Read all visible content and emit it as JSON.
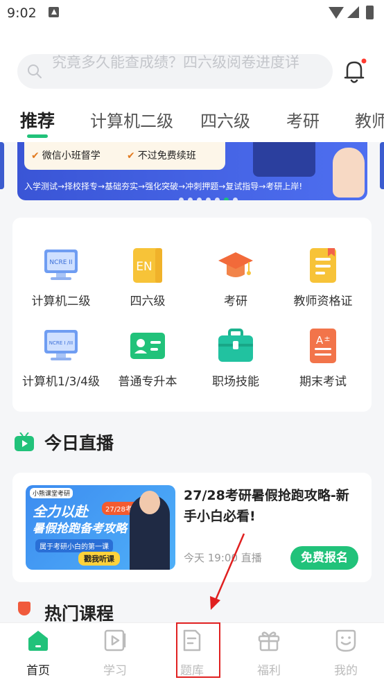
{
  "status_bar": {
    "time": "9:02"
  },
  "search": {
    "placeholder": "究竟多久能查成绩？四六级阅卷进度详"
  },
  "tabs": [
    {
      "label": "推荐",
      "active": true
    },
    {
      "label": "计算机二级"
    },
    {
      "label": "四六级"
    },
    {
      "label": "考研"
    },
    {
      "label": "教师"
    }
  ],
  "banner": {
    "features": [
      "微信小班督学",
      "不过免费续班"
    ],
    "path": "入学测试→择校择专→基础夯实→强化突破→冲刺押题→复试指导→考研上岸!",
    "active_dot": 5,
    "dot_count": 7
  },
  "categories": [
    {
      "label": "计算机二级",
      "icon": "ncre-monitor-icon",
      "icon_text": "NCRE II"
    },
    {
      "label": "四六级",
      "icon": "en-book-icon",
      "icon_text": "EN"
    },
    {
      "label": "考研",
      "icon": "graduation-cap-icon"
    },
    {
      "label": "教师资格证",
      "icon": "certificate-icon"
    },
    {
      "label": "计算机1/3/4级",
      "icon": "ncre-levels-monitor-icon",
      "icon_text": "NCRE I /III"
    },
    {
      "label": "普通专升本",
      "icon": "id-card-icon"
    },
    {
      "label": "职场技能",
      "icon": "briefcase-icon"
    },
    {
      "label": "期末考试",
      "icon": "exam-paper-icon"
    }
  ],
  "live": {
    "section_title": "今日直播",
    "course": {
      "title": "27/28考研暑假抢跑攻略-新手小白必看!",
      "time": "今天 19:00 直播",
      "button": "免费报名",
      "thumbnail": {
        "brand": "小熊课堂考研",
        "line1": "全力以赴",
        "badge": "27/28考研",
        "line2": "暑假抢跑备考攻略",
        "sub": "属于考研小白的第一课",
        "cta": "戳我听课"
      }
    }
  },
  "next_section": {
    "title": "热门课程"
  },
  "bottom_nav": [
    {
      "label": "首页",
      "icon": "home-icon",
      "active": true
    },
    {
      "label": "学习",
      "icon": "play-book-icon"
    },
    {
      "label": "题库",
      "icon": "question-bank-icon"
    },
    {
      "label": "福利",
      "icon": "gift-icon"
    },
    {
      "label": "我的",
      "icon": "smiley-profile-icon"
    }
  ],
  "colors": {
    "accent": "#21c27a",
    "annotation": "#e02020",
    "banner_blue": "#3a55d6"
  }
}
